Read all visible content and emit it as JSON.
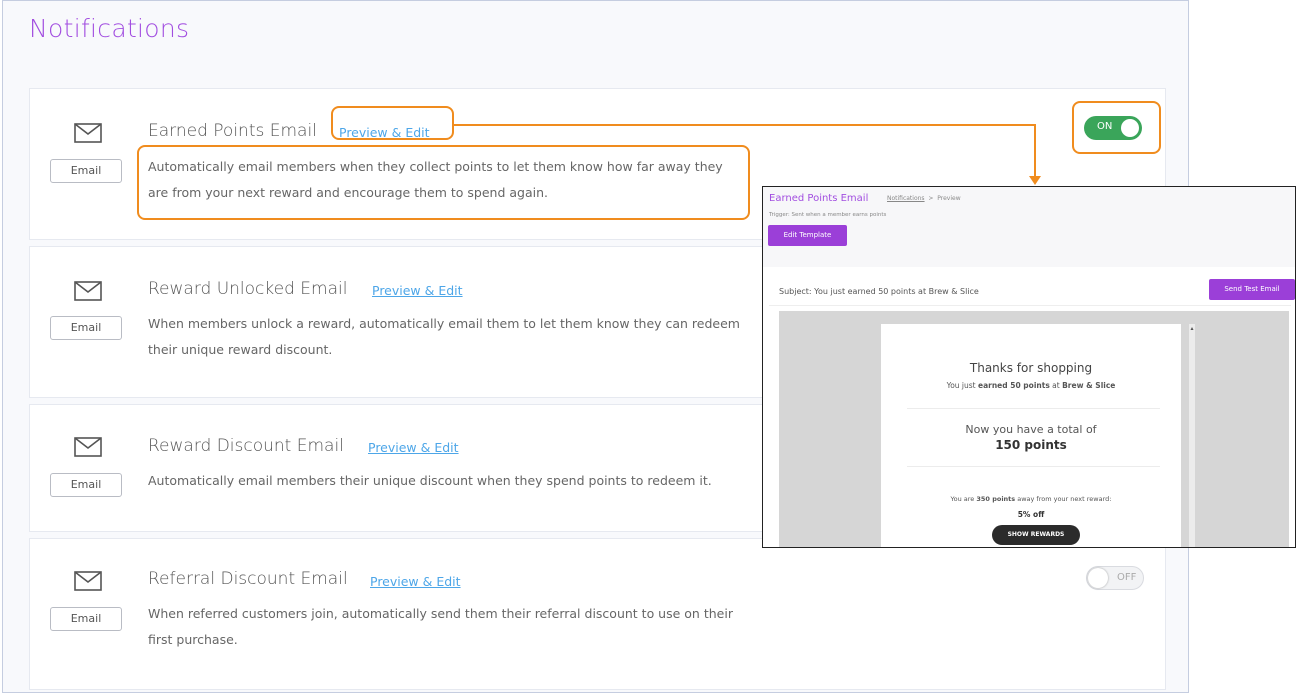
{
  "page": {
    "title": "Notifications"
  },
  "notifications": [
    {
      "title": "Earned Points Email",
      "link": "Preview & Edit",
      "badge": "Email",
      "description_lines": [
        "Automatically email members when they collect points to let them know how far away they",
        "are from your next reward and encourage them to spend again."
      ],
      "toggle": "ON"
    },
    {
      "title": "Reward Unlocked Email",
      "link": "Preview & Edit",
      "badge": "Email",
      "description_lines": [
        "When members unlock a reward, automatically email them to let them know they can redeem",
        "their unique reward discount."
      ]
    },
    {
      "title": "Reward Discount Email",
      "link": "Preview & Edit",
      "badge": "Email",
      "description_lines": [
        "Automatically email members their unique discount when they spend points to redeem it."
      ]
    },
    {
      "title": "Referral Discount Email",
      "link": "Preview & Edit",
      "badge": "Email",
      "description_lines": [
        "When referred customers join, automatically send them their referral discount to use on their",
        "first purchase."
      ],
      "toggle": "OFF"
    }
  ],
  "preview": {
    "title": "Earned Points Email",
    "breadcrumb_link": "Notifications",
    "breadcrumb_sep": ">",
    "breadcrumb_current": "Preview",
    "trigger": "Trigger: Sent when a member earns points",
    "edit_button": "Edit Template",
    "subject": "Subject: You just earned 50 points at Brew & Slice",
    "test_button": "Send Test Email",
    "email": {
      "heading": "Thanks for shopping",
      "earned_pre": "You just ",
      "earned_bold": "earned 50 points",
      "earned_mid": " at ",
      "earned_brand": "Brew & Slice",
      "total_line": "Now you have a total of",
      "total_points": "150 points",
      "away_pre": "You are ",
      "away_bold": "350 points",
      "away_post": " away from your next reward:",
      "reward": "5% off",
      "button": "SHOW REWARDS"
    }
  },
  "colors": {
    "accent": "#a24ee0",
    "highlight": "#f08c1e",
    "toggle_on": "#3aa55a",
    "link": "#4da6e8"
  },
  "icons": {
    "email": "envelope-icon"
  }
}
